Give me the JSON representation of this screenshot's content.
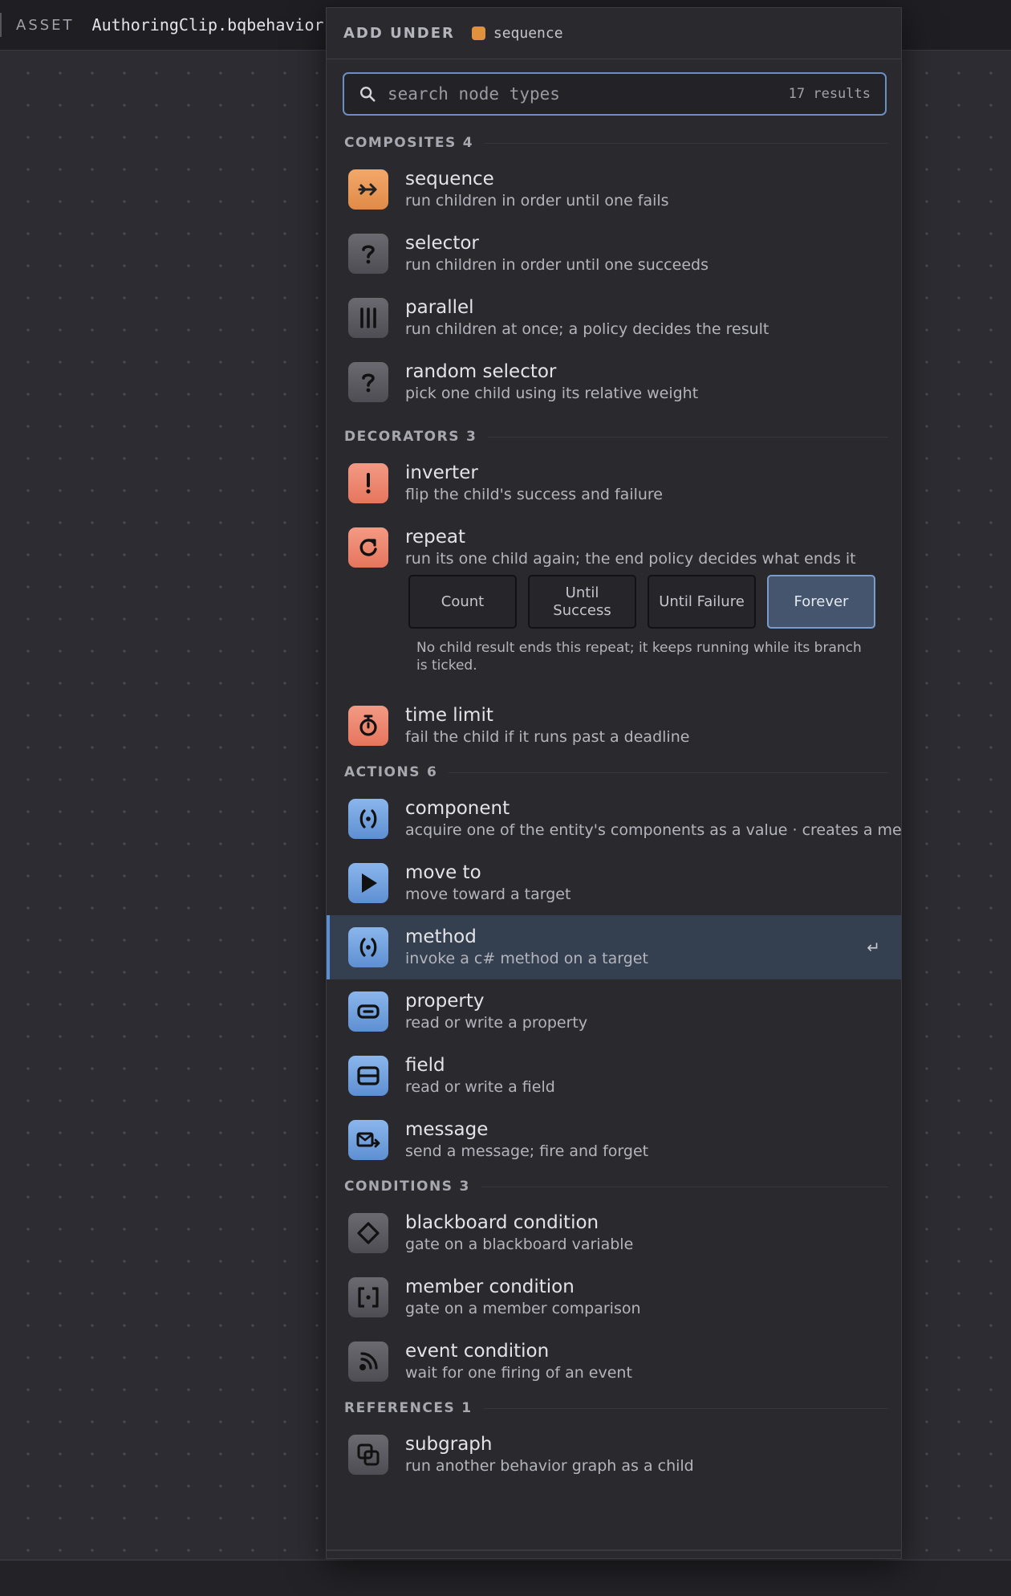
{
  "topbar": {
    "asset_label": "ASSET",
    "asset_name": "AuthoringClip.bqbehavior"
  },
  "popup": {
    "add_under_label": "ADD UNDER",
    "parent_name": "sequence",
    "parent_color": "#e0913e",
    "search": {
      "placeholder": "search node types",
      "value": "",
      "result_count": "17 results"
    },
    "sections": {
      "composites": {
        "label": "COMPOSITES",
        "count": "4",
        "items": [
          {
            "title": "sequence",
            "desc": "run children in order until one fails",
            "icon": "arrow-right-icon"
          },
          {
            "title": "selector",
            "desc": "run children in order until one succeeds",
            "icon": "question-icon"
          },
          {
            "title": "parallel",
            "desc": "run children at once; a policy decides the result",
            "icon": "bars-icon"
          },
          {
            "title": "random selector",
            "desc": "pick one child using its relative weight",
            "icon": "question-icon"
          }
        ]
      },
      "decorators": {
        "label": "DECORATORS",
        "count": "3",
        "items": [
          {
            "title": "inverter",
            "desc": "flip the child's success and failure",
            "icon": "exclamation-icon"
          },
          {
            "title": "repeat",
            "desc": "run its one child again; the end policy decides what ends it",
            "icon": "repeat-icon"
          },
          {
            "title": "time limit",
            "desc": "fail the child if it runs past a deadline",
            "icon": "stopwatch-icon"
          }
        ],
        "repeat_policies": [
          "Count",
          "Until Success",
          "Until Failure",
          "Forever"
        ],
        "repeat_selected": "Forever",
        "repeat_note": "No child result ends this repeat; it keeps running while its branch is ticked."
      },
      "actions": {
        "label": "ACTIONS",
        "count": "6",
        "items": [
          {
            "title": "component",
            "desc": "acquire one of the entity's components as a value · creates a met",
            "icon": "component-icon"
          },
          {
            "title": "move to",
            "desc": "move toward a target",
            "icon": "play-icon"
          },
          {
            "title": "method",
            "desc": "invoke a c# method on a target",
            "icon": "method-icon",
            "enter_hint": "↵"
          },
          {
            "title": "property",
            "desc": "read or write a property",
            "icon": "property-icon"
          },
          {
            "title": "field",
            "desc": "read or write a field",
            "icon": "field-icon"
          },
          {
            "title": "message",
            "desc": "send a message; fire and forget",
            "icon": "mail-send-icon"
          }
        ]
      },
      "conditions": {
        "label": "CONDITIONS",
        "count": "3",
        "items": [
          {
            "title": "blackboard condition",
            "desc": "gate on a blackboard variable",
            "icon": "diamond-icon"
          },
          {
            "title": "member condition",
            "desc": "gate on a member comparison",
            "icon": "brackets-icon"
          },
          {
            "title": "event condition",
            "desc": "wait for one firing of an event",
            "icon": "signal-icon"
          }
        ]
      },
      "references": {
        "label": "REFERENCES",
        "count": "1",
        "items": [
          {
            "title": "subgraph",
            "desc": "run another behavior graph as a child",
            "icon": "subgraph-icon"
          }
        ]
      }
    }
  },
  "colors": {
    "composite_accent": "#e0913e",
    "decorator_accent": "#e6755d",
    "action_accent": "#5e8fd1",
    "condition_accent": "#4d4d53",
    "selection_bg": "#34404f",
    "focus_border": "#6b8fc4"
  }
}
